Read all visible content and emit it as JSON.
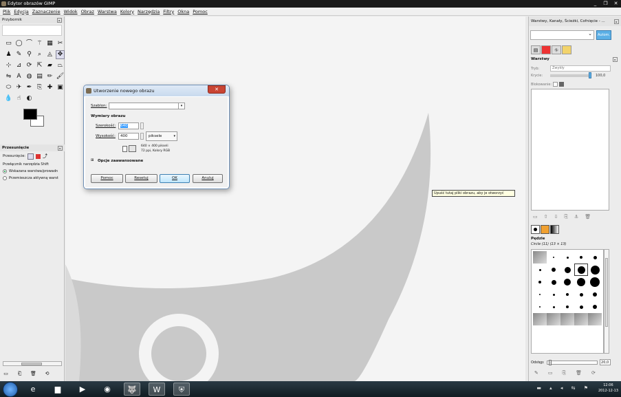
{
  "window": {
    "title": "Edytor obrazów GIMP",
    "controls": [
      "_",
      "❐",
      "✕"
    ]
  },
  "menu": [
    "Plik",
    "Edycja",
    "Zaznaczenie",
    "Widok",
    "Obraz",
    "Warstwa",
    "Kolory",
    "Narzędzia",
    "Filtry",
    "Okna",
    "Pomoc"
  ],
  "toolbox": {
    "title": "Przybornik",
    "tools": [
      {
        "icon": "rect-select-icon",
        "glyph": "▭"
      },
      {
        "icon": "ellipse-select-icon",
        "glyph": "◯"
      },
      {
        "icon": "free-select-icon",
        "glyph": "⌒"
      },
      {
        "icon": "fuzzy-select-icon",
        "glyph": "⚚"
      },
      {
        "icon": "color-select-icon",
        "glyph": "▦"
      },
      {
        "icon": "scissors-icon",
        "glyph": "✂"
      },
      {
        "icon": "foreground-select-icon",
        "glyph": "♟"
      },
      {
        "icon": "paths-icon",
        "glyph": "✎"
      },
      {
        "icon": "color-picker-icon",
        "glyph": "⚲"
      },
      {
        "icon": "zoom-icon",
        "glyph": "⌕"
      },
      {
        "icon": "measure-icon",
        "glyph": "◬"
      },
      {
        "icon": "move-icon",
        "glyph": "✥"
      },
      {
        "icon": "align-icon",
        "glyph": "⊹"
      },
      {
        "icon": "crop-icon",
        "glyph": "⊿"
      },
      {
        "icon": "rotate-icon",
        "glyph": "⟳"
      },
      {
        "icon": "scale-icon",
        "glyph": "⇱"
      },
      {
        "icon": "shear-icon",
        "glyph": "▰"
      },
      {
        "icon": "perspective-icon",
        "glyph": "⏢"
      },
      {
        "icon": "flip-icon",
        "glyph": "⇋"
      },
      {
        "icon": "text-icon",
        "glyph": "A"
      },
      {
        "icon": "bucket-fill-icon",
        "glyph": "◍"
      },
      {
        "icon": "blend-icon",
        "glyph": "▤"
      },
      {
        "icon": "pencil-icon",
        "glyph": "✏"
      },
      {
        "icon": "paintbrush-icon",
        "glyph": "🖌"
      },
      {
        "icon": "eraser-icon",
        "glyph": "⬭"
      },
      {
        "icon": "airbrush-icon",
        "glyph": "✈"
      },
      {
        "icon": "ink-icon",
        "glyph": "✒"
      },
      {
        "icon": "clone-icon",
        "glyph": "⎘"
      },
      {
        "icon": "heal-icon",
        "glyph": "✚"
      },
      {
        "icon": "perspective-clone-icon",
        "glyph": "▣"
      },
      {
        "icon": "blur-icon",
        "glyph": "💧"
      },
      {
        "icon": "smudge-icon",
        "glyph": "☝"
      },
      {
        "icon": "dodge-burn-icon",
        "glyph": "◐"
      }
    ],
    "active_tool_index": 11,
    "fg_color": "#000000",
    "bg_color": "#ffffff",
    "options": {
      "title": "Przesunięcie",
      "move_label": "Przesunięcie:",
      "toggle_label": "Przełącznik narzędzia  Shift",
      "radio1": "Wskazana warstwa/prowadn",
      "radio2": "Przemieszcza aktywną warst"
    }
  },
  "dialog": {
    "title": "Utworzenie nowego obrazu",
    "template_label": "Szablon:",
    "template_value": "",
    "size_heading": "Wymiary obrazu",
    "width_label": "Szerokość:",
    "width_value": "640",
    "height_label": "Wysokość:",
    "height_value": "400",
    "unit": "piksele",
    "info_line1": "640 × 400 pikseli",
    "info_line2": "72 ppi, Kolory RGB",
    "advanced": "Opcje zaawansowane",
    "buttons": {
      "help": "Pomoc",
      "reset": "Resetuj",
      "ok": "OK",
      "cancel": "Anuluj"
    }
  },
  "tooltip": "Upuść tutaj pliki obrazu, aby je otworzyć",
  "rightdock": {
    "title": "Warstwy, Kanały, Ścieżki, Cofnięcie - ...",
    "autom": "Autom.",
    "layers": {
      "title": "Warstwy",
      "mode_label": "Tryb:",
      "mode_value": "Zwykły",
      "opacity_label": "Krycie:",
      "opacity_value": "100,0",
      "opacity_level": 1.0,
      "lock_label": "Blokowanie:"
    },
    "brushes": {
      "title": "Pędzle",
      "current": "Circle (11) (13 × 13)",
      "spacing_label": "Odstęp:",
      "spacing_value": "20,0",
      "spacing_level": 0.2
    }
  },
  "taskbar": {
    "apps": [
      {
        "icon": "ie-icon",
        "glyph": "e"
      },
      {
        "icon": "explorer-icon",
        "glyph": "▆"
      },
      {
        "icon": "media-player-icon",
        "glyph": "▶"
      },
      {
        "icon": "firefox-icon",
        "glyph": "◉"
      },
      {
        "icon": "gimp-icon",
        "glyph": "🐺"
      },
      {
        "icon": "word-icon",
        "glyph": "W"
      },
      {
        "icon": "security-icon",
        "glyph": "⛨"
      }
    ],
    "time": "12:06",
    "date": "2012-12-13"
  }
}
